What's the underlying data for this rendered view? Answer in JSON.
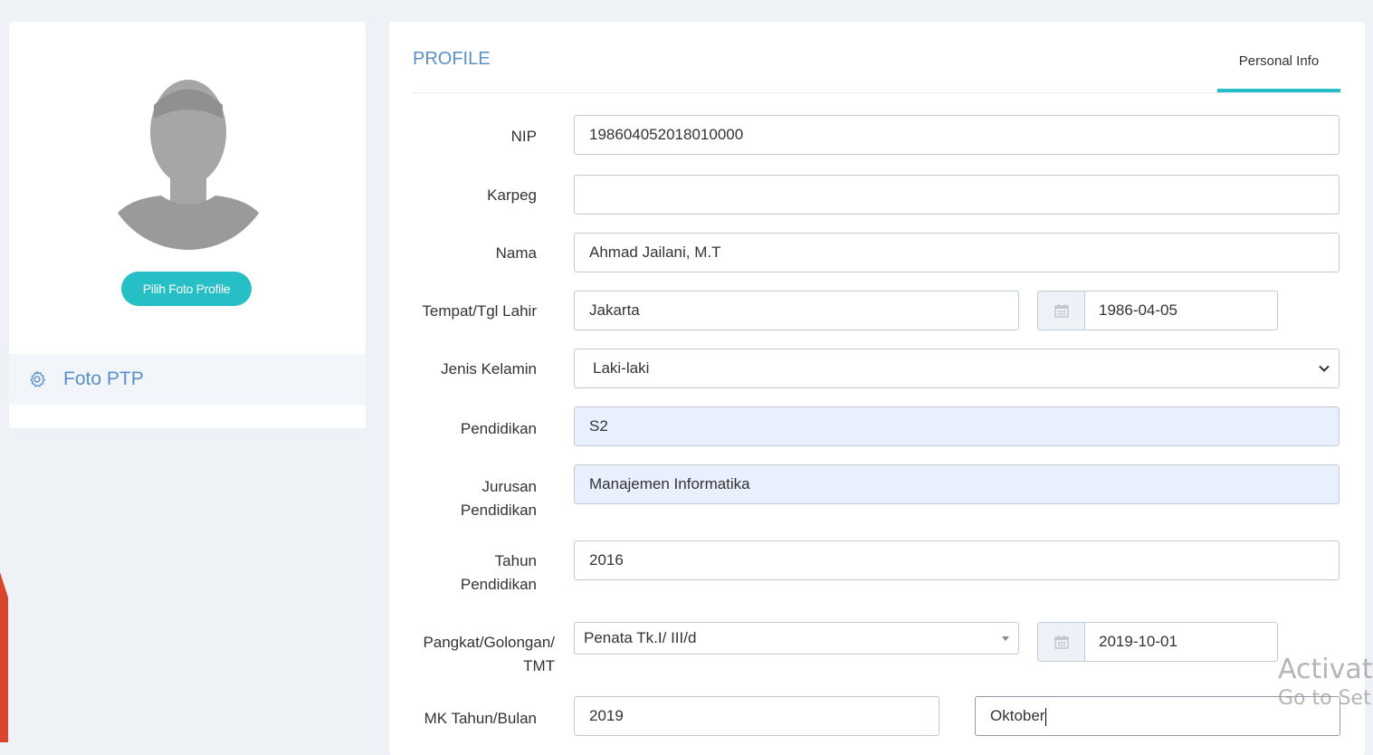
{
  "sidebar": {
    "pick_photo_label": "Pilih Foto Profile",
    "menu_item_label": "Foto PTP"
  },
  "header": {
    "title": "PROFILE",
    "tab_label": "Personal Info"
  },
  "form": {
    "nip": {
      "label": "NIP",
      "value": "198604052018010000"
    },
    "karpeg": {
      "label": "Karpeg",
      "value": ""
    },
    "nama": {
      "label": "Nama",
      "value": "Ahmad Jailani, M.T"
    },
    "tempat_tgl_lahir": {
      "label": "Tempat/Tgl Lahir",
      "place": "Jakarta",
      "date": "1986-04-05"
    },
    "jenis_kelamin": {
      "label": "Jenis Kelamin",
      "value": "Laki-laki"
    },
    "pendidikan": {
      "label": "Pendidikan",
      "value": "S2"
    },
    "jurusan": {
      "label_line1": "Jurusan",
      "label_line2": "Pendidikan",
      "value": "Manajemen Informatika"
    },
    "tahun": {
      "label_line1": "Tahun",
      "label_line2": "Pendidikan",
      "value": "2016"
    },
    "pangkat": {
      "label_line1": "Pangkat/Golongan/",
      "label_line2": "TMT",
      "value": "Penata Tk.I/ III/d",
      "date": "2019-10-01"
    },
    "mk": {
      "label": "MK Tahun/Bulan",
      "year": "2019",
      "month": "Oktober"
    }
  },
  "watermark": {
    "line1": "Activate",
    "line2": "Go to Set"
  },
  "colors": {
    "accent": "#27bfc6",
    "link": "#5b8fca",
    "background": "#eef1f6"
  }
}
